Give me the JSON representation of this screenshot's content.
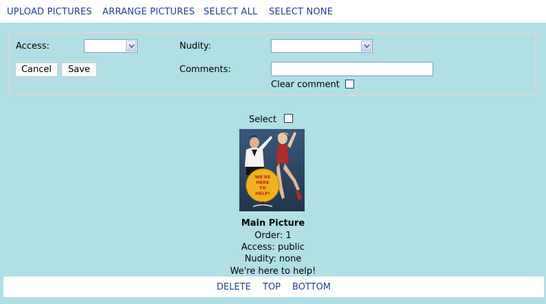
{
  "topnav": {
    "upload": "UPLOAD PICTURES",
    "arrange": "ARRANGE PICTURES",
    "select_all": "SELECT ALL",
    "select_none": "SELECT NONE"
  },
  "form": {
    "access_label": "Access:",
    "access_value": "",
    "nudity_label": "Nudity:",
    "nudity_value": "",
    "cancel_label": "Cancel",
    "save_label": "Save",
    "comments_label": "Comments:",
    "comments_value": "",
    "clear_comment_label": "Clear comment"
  },
  "picture": {
    "select_label": "Select",
    "poster_text": "WE'RE HERE TO HELP!",
    "title": "Main Picture",
    "order": "Order: 1",
    "access": "Access: public",
    "nudity": "Nudity: none",
    "caption": "We're here to help!"
  },
  "actions": {
    "delete": "DELETE",
    "top": "TOP",
    "bottom": "BOTTOM"
  },
  "colors": {
    "background": "#b0dfe5",
    "link": "#1f3d9b"
  }
}
